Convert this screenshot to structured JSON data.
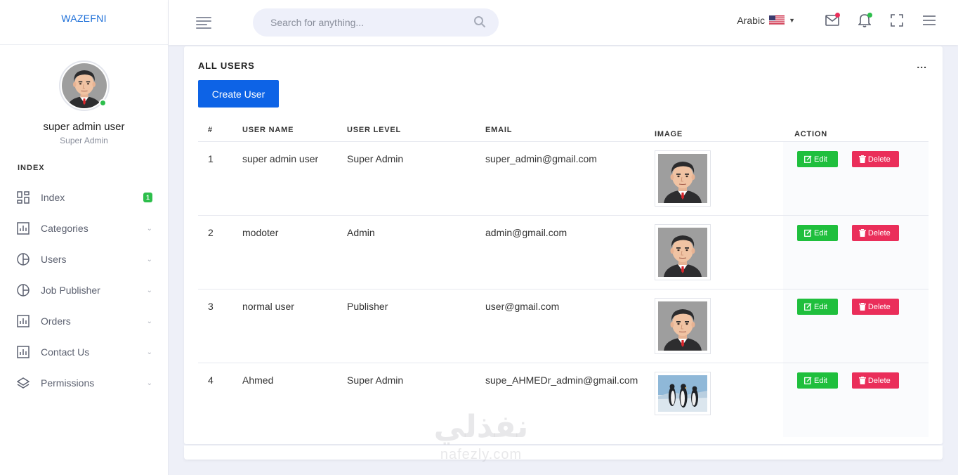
{
  "brand": "WAZEFNI",
  "profile": {
    "name": "super admin user",
    "role": "Super Admin",
    "status_color": "#2dbe4b"
  },
  "sidebar": {
    "heading": "INDEX",
    "items": [
      {
        "label": "Index",
        "icon": "dashboard-icon",
        "badge": "1"
      },
      {
        "label": "Categories",
        "icon": "chart-icon"
      },
      {
        "label": "Users",
        "icon": "pie-icon"
      },
      {
        "label": "Job Publisher",
        "icon": "pie-icon"
      },
      {
        "label": "Orders",
        "icon": "chart-icon"
      },
      {
        "label": "Contact Us",
        "icon": "chart-icon"
      },
      {
        "label": "Permissions",
        "icon": "layers-icon"
      }
    ]
  },
  "topbar": {
    "search_placeholder": "Search for anything...",
    "language": "Arabic",
    "flag_icon": "us-flag-icon",
    "mail_dot_color": "#ea2e5a",
    "bell_dot_color": "#2dbe4b"
  },
  "card": {
    "title": "ALL USERS",
    "more": "...",
    "create_label": "Create User"
  },
  "table": {
    "headers": {
      "num": "#",
      "name": "USER NAME",
      "level": "USER LEVEL",
      "email": "EMAIL",
      "image": "IMAGE",
      "action": "ACTION"
    },
    "rows": [
      {
        "num": "1",
        "name": "super admin user",
        "level": "Super Admin",
        "email": "super_admin@gmail.com",
        "image": "avatar-man"
      },
      {
        "num": "2",
        "name": "modoter",
        "level": "Admin",
        "email": "admin@gmail.com",
        "image": "avatar-man"
      },
      {
        "num": "3",
        "name": "normal user",
        "level": "Publisher",
        "email": "user@gmail.com",
        "image": "avatar-man"
      },
      {
        "num": "4",
        "name": "Ahmed",
        "level": "Super Admin",
        "email": "supe_AHMEDr_admin@gmail.com",
        "image": "penguins"
      }
    ],
    "edit_label": "Edit",
    "delete_label": "Delete"
  },
  "colors": {
    "primary": "#0d63e6",
    "edit": "#1fbf3d",
    "delete": "#ea2e5a",
    "brand": "#1d6fd8"
  },
  "watermark": {
    "arabic": "نفذلي",
    "latin": "nafezly.com"
  }
}
